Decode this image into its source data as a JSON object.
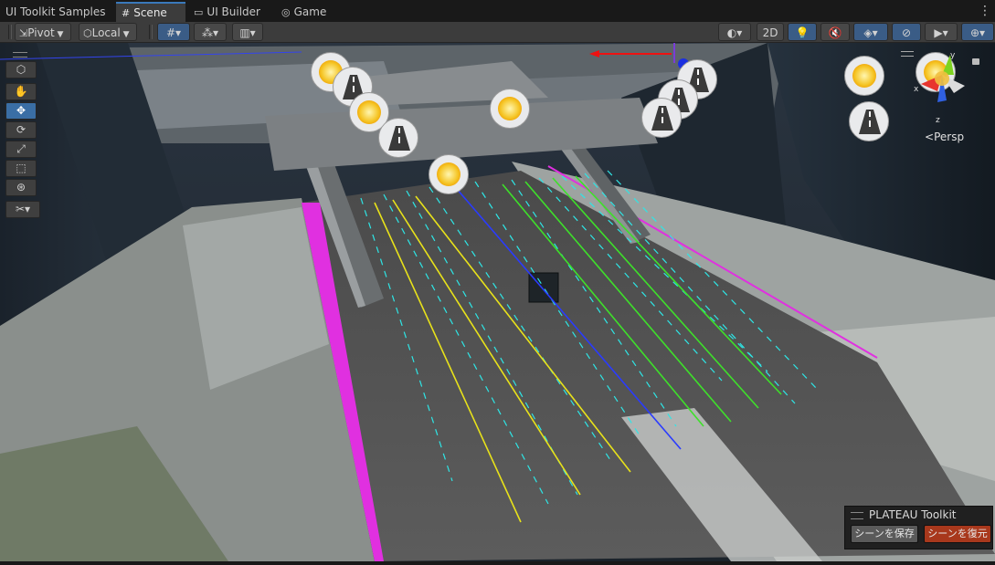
{
  "tabs": [
    {
      "label": "UI Toolkit Samples",
      "icon": "none"
    },
    {
      "label": "Scene",
      "icon": "hash-grid-icon"
    },
    {
      "label": "UI Builder",
      "icon": "window-icon"
    },
    {
      "label": "Game",
      "icon": "gamepad-icon"
    }
  ],
  "active_tab": "Scene",
  "toolbar": {
    "pivot_label": "Pivot",
    "local_label": "Local",
    "mode_2d_label": "2D"
  },
  "scene": {
    "projection_label": "Persp",
    "gizmo_axes": [
      "x",
      "y",
      "z"
    ],
    "colors": {
      "lane_cyan": "#2ee6e6",
      "lane_yellow": "#e8e21a",
      "lane_blue": "#2a3bff",
      "lane_green": "#3ee02a",
      "boundary_magenta": "#e030e0",
      "accent_blue": "#3a6ea5"
    }
  },
  "plateau_panel": {
    "title": "PLATEAU Toolkit",
    "save_label": "シーンを保存",
    "restore_label": "シーンを復元",
    "save_color": "#5a5a5a",
    "restore_color": "#a8381c"
  }
}
